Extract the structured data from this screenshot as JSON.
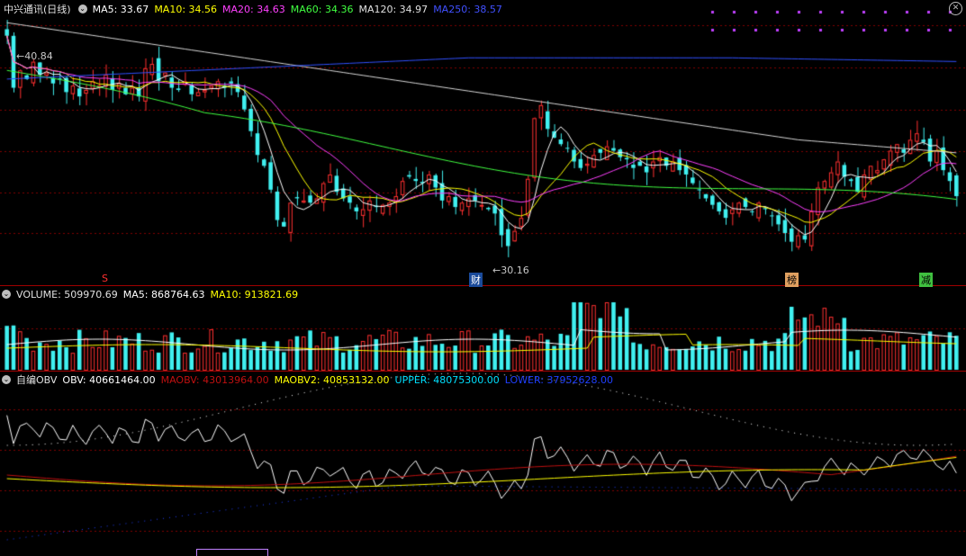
{
  "main_legend": {
    "title": "中兴通讯(日线)",
    "items": [
      {
        "label": "MA5: 33.67",
        "color": "#ffffff"
      },
      {
        "label": "MA10: 34.56",
        "color": "#ffff00"
      },
      {
        "label": "MA20: 34.63",
        "color": "#ff40ff"
      },
      {
        "label": "MA60: 34.36",
        "color": "#40ff40"
      },
      {
        "label": "MA120: 34.97",
        "color": "#e0e0e0"
      },
      {
        "label": "MA250: 38.57",
        "color": "#4050ff"
      }
    ]
  },
  "price_labels": {
    "high": "40.84",
    "low": "30.16"
  },
  "events": {
    "s": "S",
    "cai": "财",
    "bang": "榜",
    "jian": "减"
  },
  "volume_legend": {
    "title": "VOLUME: 509970.69",
    "items": [
      {
        "label": "MA5: 868764.63",
        "color": "#ffffff"
      },
      {
        "label": "MA10: 913821.69",
        "color": "#ffff00"
      }
    ]
  },
  "obv_legend": {
    "title": "自编OBV",
    "items": [
      {
        "label": "OBV: 40661464.00",
        "color": "#ffffff"
      },
      {
        "label": "MAOBV: 43013964.00",
        "color": "#c01010"
      },
      {
        "label": "MAOBV2: 40853132.00",
        "color": "#ffff00"
      },
      {
        "label": "UPPER: 48075300.00",
        "color": "#00e0ff"
      },
      {
        "label": "LOWER: 37952628.00",
        "color": "#2040ff"
      }
    ]
  },
  "colors": {
    "up": "#ff3030",
    "down": "#40f0f0",
    "grid": "#800000",
    "separator": "#a00000"
  },
  "chart_data": {
    "type": "candlestick",
    "title": "中兴通讯(日线)",
    "price_marks": {
      "max": 40.84,
      "min": 30.16
    },
    "ohlc_note": "approximate daily candles read from screenshot",
    "close": [
      40.6,
      38.2,
      39.0,
      38.6,
      39.4,
      38.8,
      38.9,
      38.4,
      38.6,
      38.0,
      38.3,
      37.8,
      38.1,
      38.5,
      38.3,
      38.8,
      38.1,
      38.4,
      37.9,
      38.2,
      37.8,
      39.1,
      39.3,
      38.5,
      38.9,
      38.2,
      38.1,
      38.5,
      37.9,
      38.0,
      38.1,
      38.3,
      38.5,
      38.2,
      38.4,
      38.0,
      37.2,
      36.2,
      35.1,
      34.6,
      33.5,
      32.1,
      31.8,
      32.9,
      33.1,
      33.0,
      32.9,
      33.1,
      33.8,
      34.2,
      33.4,
      33.1,
      32.9,
      32.5,
      32.6,
      33.0,
      32.7,
      32.8,
      32.9,
      33.2,
      33.9,
      34.1,
      33.9,
      33.8,
      34.2,
      33.6,
      33.0,
      33.2,
      32.7,
      32.9,
      33.1,
      33.0,
      32.8,
      32.6,
      32.4,
      31.4,
      30.9,
      31.6,
      32.2,
      34.0,
      36.8,
      37.4,
      36.3,
      35.9,
      35.6,
      35.4,
      34.8,
      34.5,
      34.7,
      35.1,
      35.2,
      35.5,
      35.3,
      35.0,
      34.9,
      34.5,
      34.6,
      34.3,
      34.8,
      35.0,
      34.6,
      34.8,
      34.4,
      34.2,
      33.8,
      33.5,
      33.1,
      32.8,
      32.5,
      32.2,
      32.6,
      32.9,
      32.7,
      32.5,
      32.9,
      32.6,
      32.3,
      31.9,
      31.5,
      31.1,
      31.4,
      31.2,
      32.5,
      33.6,
      33.9,
      34.3,
      34.8,
      34.1,
      33.9,
      33.4,
      34.2,
      34.6,
      34.4,
      34.9,
      35.3,
      35.6,
      35.2,
      35.8,
      36.1,
      35.7,
      34.8,
      35.3,
      34.4,
      33.9,
      33.2
    ]
  }
}
